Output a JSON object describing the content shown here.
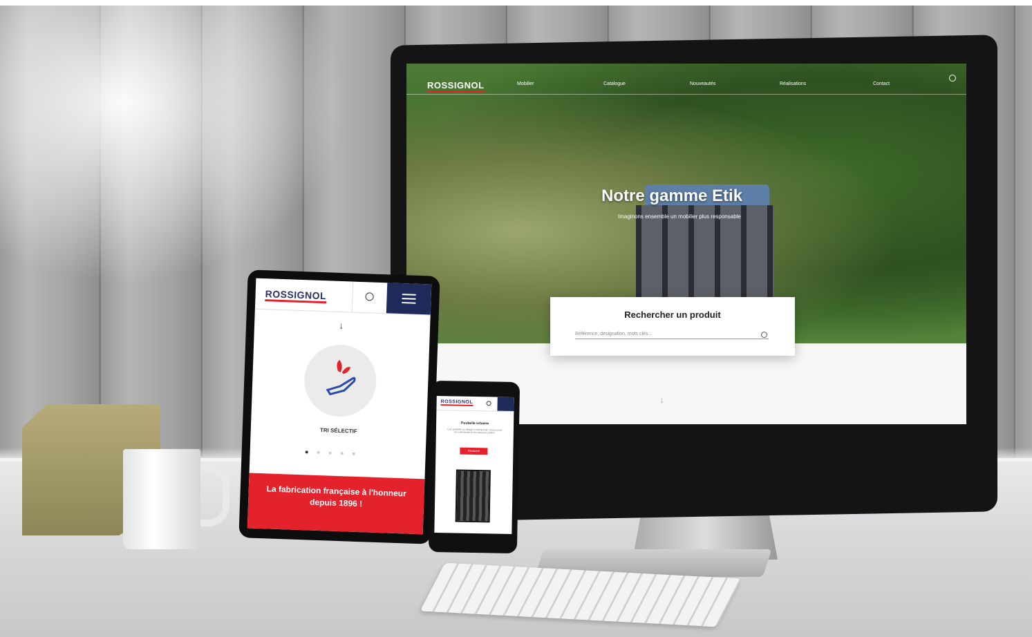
{
  "colors": {
    "brand_red": "#e3222c",
    "brand_navy": "#1f2a5a"
  },
  "brand": {
    "logo": "ROSSIGNOL"
  },
  "desktop": {
    "nav_items": [
      "Mobilier",
      "Catalogue",
      "Nouveautés",
      "Réalisations",
      "Contact"
    ],
    "hero_title": "Notre gamme Etik",
    "hero_subtitle": "Imaginons ensemble un mobilier plus responsable",
    "search_title": "Rechercher un produit",
    "search_placeholder": "Référence, désignation, mots clés..."
  },
  "tablet": {
    "category_label": "TRI SÉLECTIF",
    "banner_text": "La fabrication française à l'honneur depuis 1896 !"
  },
  "phone": {
    "product_title": "Poubelle urbaine",
    "product_text": "Une poubelle au design contemporain conçue pour les collectivités et les espaces publics.",
    "button_label": "Découvrir"
  },
  "icons": [
    "search-icon",
    "menu-icon",
    "hand-leaf-icon",
    "arrow-down-icon"
  ]
}
